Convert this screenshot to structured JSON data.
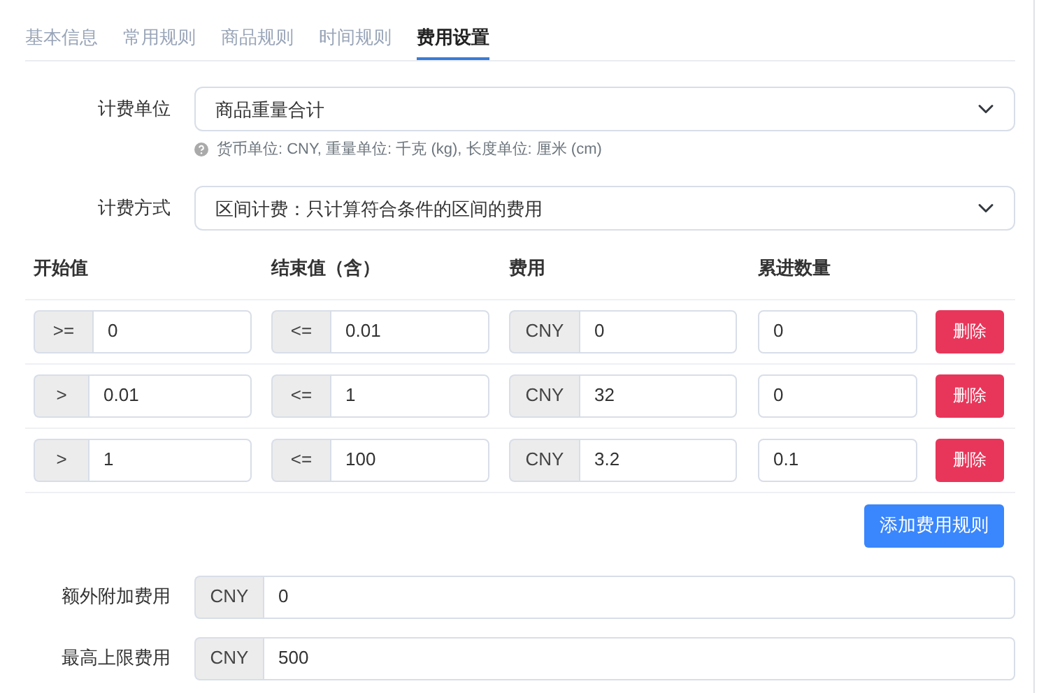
{
  "tabs": [
    {
      "label": "基本信息",
      "selected": false
    },
    {
      "label": "常用规则",
      "selected": false
    },
    {
      "label": "商品规则",
      "selected": false
    },
    {
      "label": "时间规则",
      "selected": false
    },
    {
      "label": "费用设置",
      "selected": true
    }
  ],
  "billing_unit": {
    "label": "计费单位",
    "value": "商品重量合计",
    "help": "货币单位: CNY, 重量单位: 千克 (kg), 长度单位: 厘米 (cm)"
  },
  "billing_method": {
    "label": "计费方式",
    "value": "区间计费：只计算符合条件的区间的费用"
  },
  "table": {
    "columns": [
      "开始值",
      "结束值（含）",
      "费用",
      "累进数量"
    ],
    "rows": [
      {
        "start_op": ">=",
        "start": "0",
        "end_op": "<=",
        "end": "0.01",
        "currency": "CNY",
        "fee": "0",
        "step": "0",
        "delete": "删除"
      },
      {
        "start_op": ">",
        "start": "0.01",
        "end_op": "<=",
        "end": "1",
        "currency": "CNY",
        "fee": "32",
        "step": "0",
        "delete": "删除"
      },
      {
        "start_op": ">",
        "start": "1",
        "end_op": "<=",
        "end": "100",
        "currency": "CNY",
        "fee": "3.2",
        "step": "0.1",
        "delete": "删除"
      }
    ]
  },
  "add_button": "添加费用规则",
  "extra_fee": {
    "label": "额外附加费用",
    "currency": "CNY",
    "value": "0"
  },
  "max_fee": {
    "label": "最高上限费用",
    "currency": "CNY",
    "value": "500"
  }
}
